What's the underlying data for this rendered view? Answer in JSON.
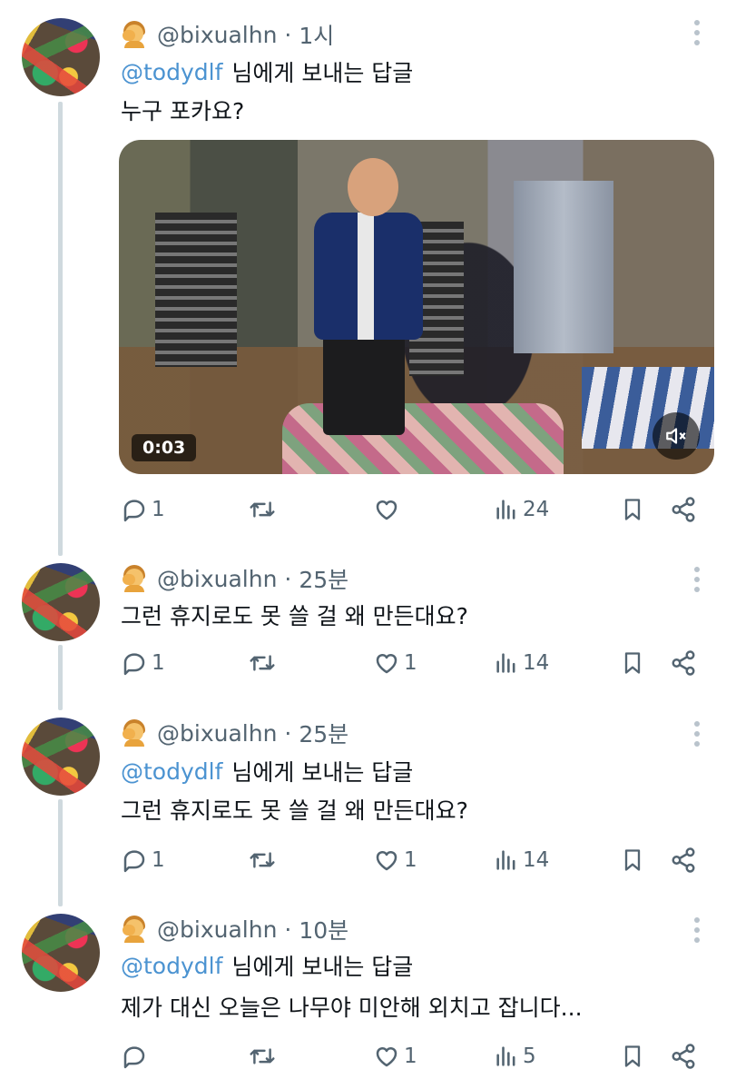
{
  "tweets": [
    {
      "handle": "@bixualhn",
      "time": "1시",
      "reply_mention": "@todydlf",
      "reply_suffix": "님에게 보내는 답글",
      "text": "누구 포카요?",
      "media": {
        "type": "video",
        "timestamp": "0:03",
        "muted_icon": "mute-icon"
      },
      "stats": {
        "replies": "1",
        "retweets": "",
        "likes": "",
        "views": "24"
      }
    },
    {
      "handle": "@bixualhn",
      "time": "25분",
      "reply_mention": "",
      "reply_suffix": "",
      "text": "그런 휴지로도 못 쓸 걸 왜 만든대요?",
      "stats": {
        "replies": "1",
        "retweets": "",
        "likes": "1",
        "views": "14"
      }
    },
    {
      "handle": "@bixualhn",
      "time": "25분",
      "reply_mention": "@todydlf",
      "reply_suffix": "님에게 보내는 답글",
      "text": "그런 휴지로도 못 쓸 걸 왜 만든대요?",
      "stats": {
        "replies": "1",
        "retweets": "",
        "likes": "1",
        "views": "14"
      }
    },
    {
      "handle": "@bixualhn",
      "time": "10분",
      "reply_mention": "@todydlf",
      "reply_suffix": "님에게 보내는 답글",
      "text": "제가 대신 오늘은 나무야 미안해 외치고 잡니다...",
      "stats": {
        "replies": "",
        "retweets": "",
        "likes": "1",
        "views": "5"
      }
    }
  ],
  "colors": {
    "mention": "#4b93d1",
    "muted_text": "#536471",
    "thread_line": "#cfd9de"
  },
  "icons": [
    "reply-icon",
    "retweet-icon",
    "like-icon",
    "views-icon",
    "bookmark-icon",
    "share-icon",
    "more-icon",
    "facepalm-emoji-icon"
  ]
}
